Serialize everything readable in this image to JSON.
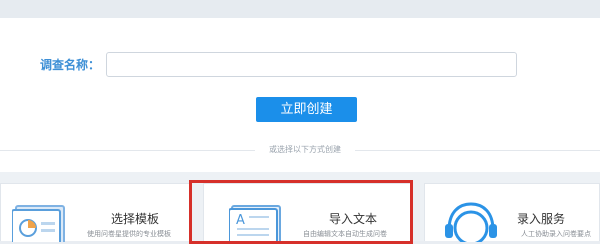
{
  "form": {
    "survey_name_label": "调查名称：",
    "survey_name_value": "",
    "create_button": "立即创建"
  },
  "divider": {
    "text": "或选择以下方式创建"
  },
  "options": [
    {
      "title": "选择模板",
      "desc": "使用问卷星提供的专业模板",
      "icon": "template-icon"
    },
    {
      "title": "导入文本",
      "desc": "自由编辑文本自动生成问卷",
      "icon": "import-text-icon"
    },
    {
      "title": "录入服务",
      "desc": "人工协助录入问卷要点",
      "icon": "headset-icon"
    }
  ],
  "colors": {
    "accent": "#1b8fea",
    "label": "#3d8fd6",
    "highlight": "#d6302a"
  }
}
